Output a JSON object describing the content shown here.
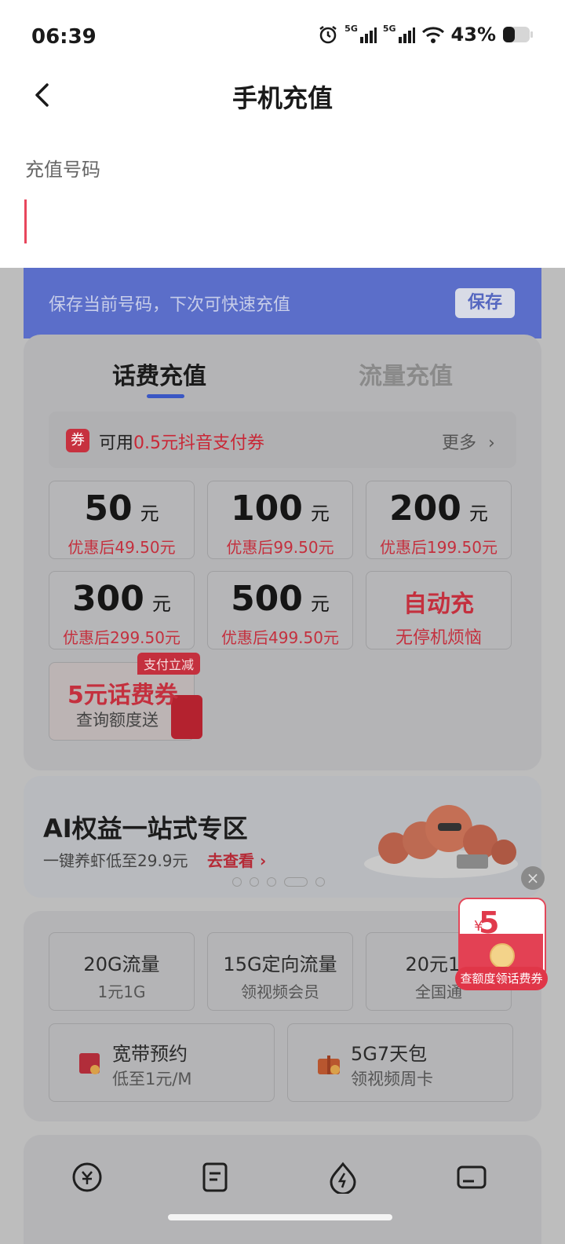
{
  "status": {
    "time": "06:39",
    "battery_pct": "43%",
    "net1": "5G",
    "net2": "5G"
  },
  "header": {
    "title": "手机充值"
  },
  "form": {
    "label": "充值号码"
  },
  "save_bar": {
    "text": "保存当前号码，下次可快速充值",
    "button": "保存"
  },
  "tabs": [
    {
      "label": "话费充值",
      "active": true
    },
    {
      "label": "流量充值",
      "active": false
    }
  ],
  "coupon": {
    "tag": "券",
    "prefix": "可用",
    "highlight": "0.5元抖音支付券",
    "more": "更多"
  },
  "amounts": [
    {
      "value": "50",
      "unit": "元",
      "sub": "优惠后49.50元"
    },
    {
      "value": "100",
      "unit": "元",
      "sub": "优惠后99.50元"
    },
    {
      "value": "200",
      "unit": "元",
      "sub": "优惠后199.50元"
    },
    {
      "value": "300",
      "unit": "元",
      "sub": "优惠后299.50元"
    },
    {
      "value": "500",
      "unit": "元",
      "sub": "优惠后499.50元"
    }
  ],
  "auto": {
    "title": "自动充",
    "sub": "无停机烦恼"
  },
  "voucher": {
    "badge": "支付立减",
    "title": "5元话费券",
    "sub": "查询额度送"
  },
  "ai": {
    "title": "AI权益一站式专区",
    "sub": "一键养虾低至29.9元",
    "link": "去查看"
  },
  "services": [
    {
      "title": "20G流量",
      "sub": "1元1G"
    },
    {
      "title": "15G定向流量",
      "sub": "领视频会员"
    },
    {
      "title": "20元10",
      "sub": "全国通"
    }
  ],
  "services_wide": [
    {
      "title": "宽带预约",
      "sub": "低至1元/M"
    },
    {
      "title": "5G7天包",
      "sub": "领视频周卡"
    }
  ],
  "float": {
    "yen": "¥",
    "amount": "5",
    "label": "查额度领话费券",
    "close": "×"
  },
  "colors": {
    "accent_red": "#c4303e",
    "save_blue": "#5b6ec9",
    "tab_blue": "#3a57c4"
  }
}
